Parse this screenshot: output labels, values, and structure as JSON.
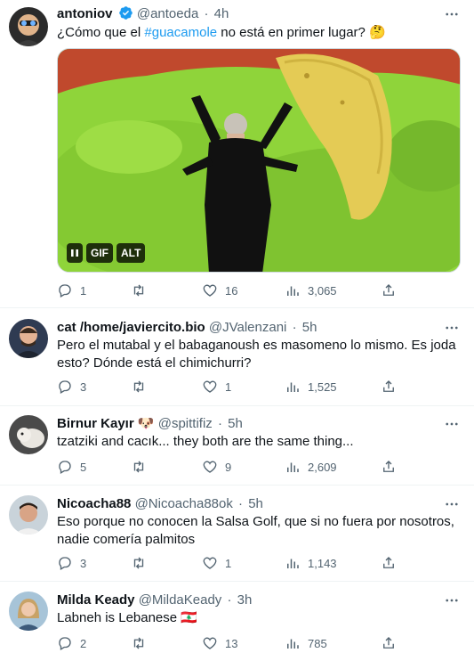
{
  "tweets": [
    {
      "name": "antoniov",
      "verified": true,
      "handle": "@antoeda",
      "time": "4h",
      "text_before": "¿Cómo que el ",
      "hashtag": "#guacamole",
      "text_after": " no está en primer lugar? 🤔",
      "media": {
        "gif_label": "GIF",
        "alt_label": "ALT"
      },
      "replies": "1",
      "retweets": "",
      "likes": "16",
      "views": "3,065"
    },
    {
      "name": "cat /home/javiercito.bio",
      "handle": "@JValenzani",
      "time": "5h",
      "text": "Pero el mutabal y el babaganoush es masomeno lo mismo. Es joda esto? Dónde está el chimichurri?",
      "replies": "3",
      "retweets": "",
      "likes": "1",
      "views": "1,525"
    },
    {
      "name": "Birnur Kayır 🐶",
      "handle": "@spittifiz",
      "time": "5h",
      "text": "tzatziki and cacık... they both are the same thing...",
      "replies": "5",
      "retweets": "",
      "likes": "9",
      "views": "2,609"
    },
    {
      "name": "Nicoacha88",
      "handle": "@Nicoacha88ok",
      "time": "5h",
      "text": "Eso porque no conocen la Salsa Golf, que si no fuera por nosotros, nadie comería palmitos",
      "replies": "3",
      "retweets": "",
      "likes": "1",
      "views": "1,143"
    },
    {
      "name": "Milda Keady",
      "handle": "@MildaKeady",
      "time": "3h",
      "text": "Labneh is Lebanese 🇱🇧",
      "replies": "2",
      "retweets": "",
      "likes": "13",
      "views": "785"
    }
  ],
  "colors": {
    "accent": "#1d9bf0",
    "muted": "#536471",
    "border": "#eff3f4"
  },
  "icons": [
    "reply-icon",
    "retweet-icon",
    "like-icon",
    "views-icon",
    "share-icon",
    "more-icon",
    "verified-badge-icon"
  ]
}
